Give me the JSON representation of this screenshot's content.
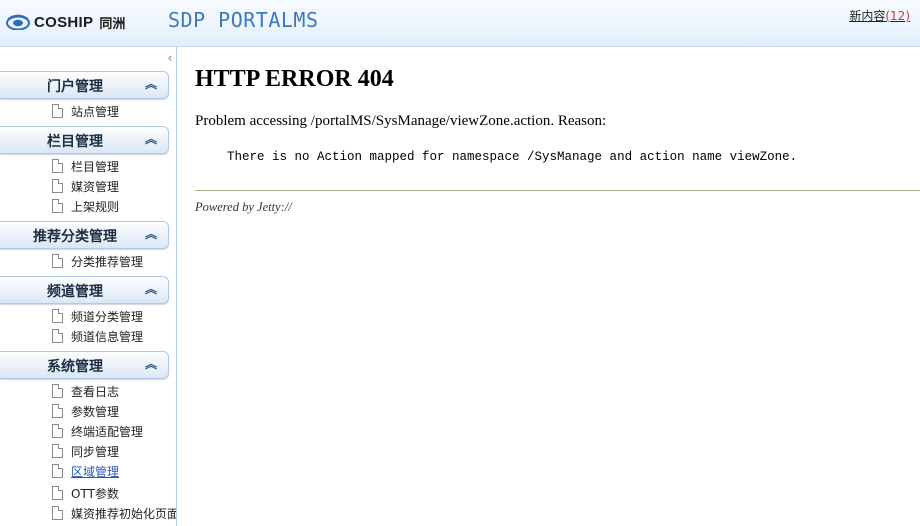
{
  "header": {
    "brand": "COSHIP",
    "brand_cn": "同洲",
    "title": "SDP PORTALMS",
    "new_content_label": "新内容",
    "new_content_count": "12"
  },
  "sidebar": {
    "collapse_icon": "chevron-left-icon",
    "groups": [
      {
        "title": "门户管理",
        "items": [
          "站点管理"
        ]
      },
      {
        "title": "栏目管理",
        "items": [
          "栏目管理",
          "媒资管理",
          "上架规则"
        ]
      },
      {
        "title": "推荐分类管理",
        "items": [
          "分类推荐管理"
        ]
      },
      {
        "title": "频道管理",
        "items": [
          "频道分类管理",
          "频道信息管理"
        ]
      },
      {
        "title": "系统管理",
        "items": [
          "查看日志",
          "参数管理",
          "终端适配管理",
          "同步管理",
          "区域管理",
          "OTT参数",
          "媒资推荐初始化页面"
        ]
      }
    ],
    "active_item": "区域管理"
  },
  "error_page": {
    "title": "HTTP ERROR 404",
    "problem": "Problem accessing /portalMS/SysManage/viewZone.action. Reason:",
    "detail": "There is no Action mapped for namespace /SysManage and action name viewZone.",
    "powered_by": "Powered by Jetty://"
  }
}
